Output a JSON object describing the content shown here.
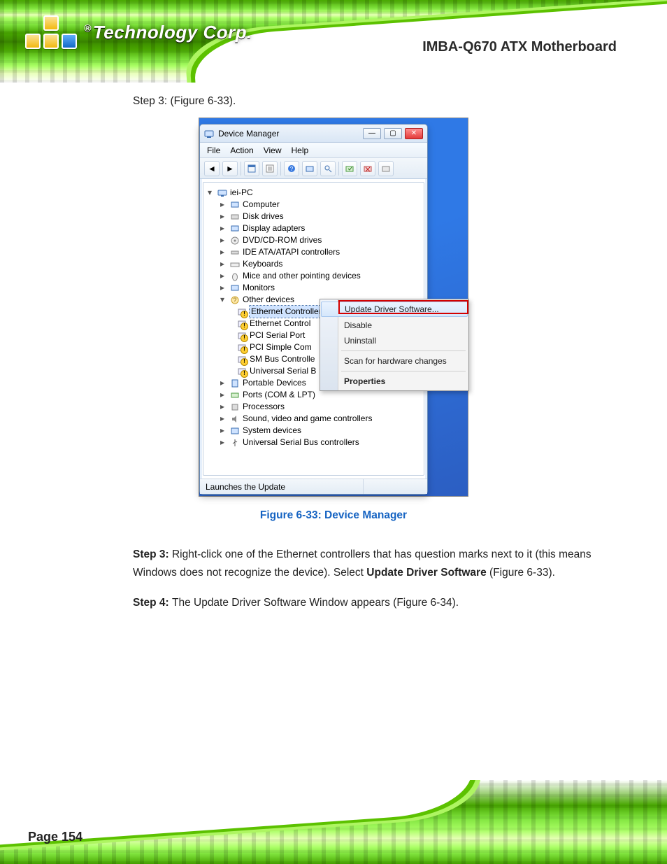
{
  "doc": {
    "product": "IMBA-Q670 ATX Motherboard",
    "brand_suffix": "Technology Corp.",
    "brand_reg": "®",
    "page_number": "Page 154",
    "step3": "Step 3:  ",
    "step3_rest": "(Figure 6-33).",
    "figure_caption": "Figure 6-33: Device Manager",
    "step4": "Step 4:  ",
    "step4_rest": "The Update Driver Software Window appears (Figure 6-34).",
    "step3_bold": "Update Driver Software",
    "step3_lead": "Right-click one of the Ethernet controllers that has question marks next to it (this means Windows does not recognize the device). Select ",
    "step3_tail": " "
  },
  "window": {
    "title": "Device Manager",
    "menus": [
      "File",
      "Action",
      "View",
      "Help"
    ],
    "status": "Launches the Update",
    "root": "iei-PC",
    "categories": [
      "Computer",
      "Disk drives",
      "Display adapters",
      "DVD/CD-ROM drives",
      "IDE ATA/ATAPI controllers",
      "Keyboards",
      "Mice and other pointing devices",
      "Monitors"
    ],
    "other_label": "Other devices",
    "other_children": [
      "Ethernet Controller",
      "Ethernet Control",
      "PCI Serial Port",
      "PCI Simple Com",
      "SM Bus Controlle",
      "Universal Serial B"
    ],
    "after_other": [
      "Portable Devices",
      "Ports (COM & LPT)",
      "Processors",
      "Sound, video and game controllers",
      "System devices",
      "Universal Serial Bus controllers"
    ]
  },
  "context_menu": {
    "items": [
      "Update Driver Software...",
      "Disable",
      "Uninstall",
      "Scan for hardware changes",
      "Properties"
    ]
  }
}
